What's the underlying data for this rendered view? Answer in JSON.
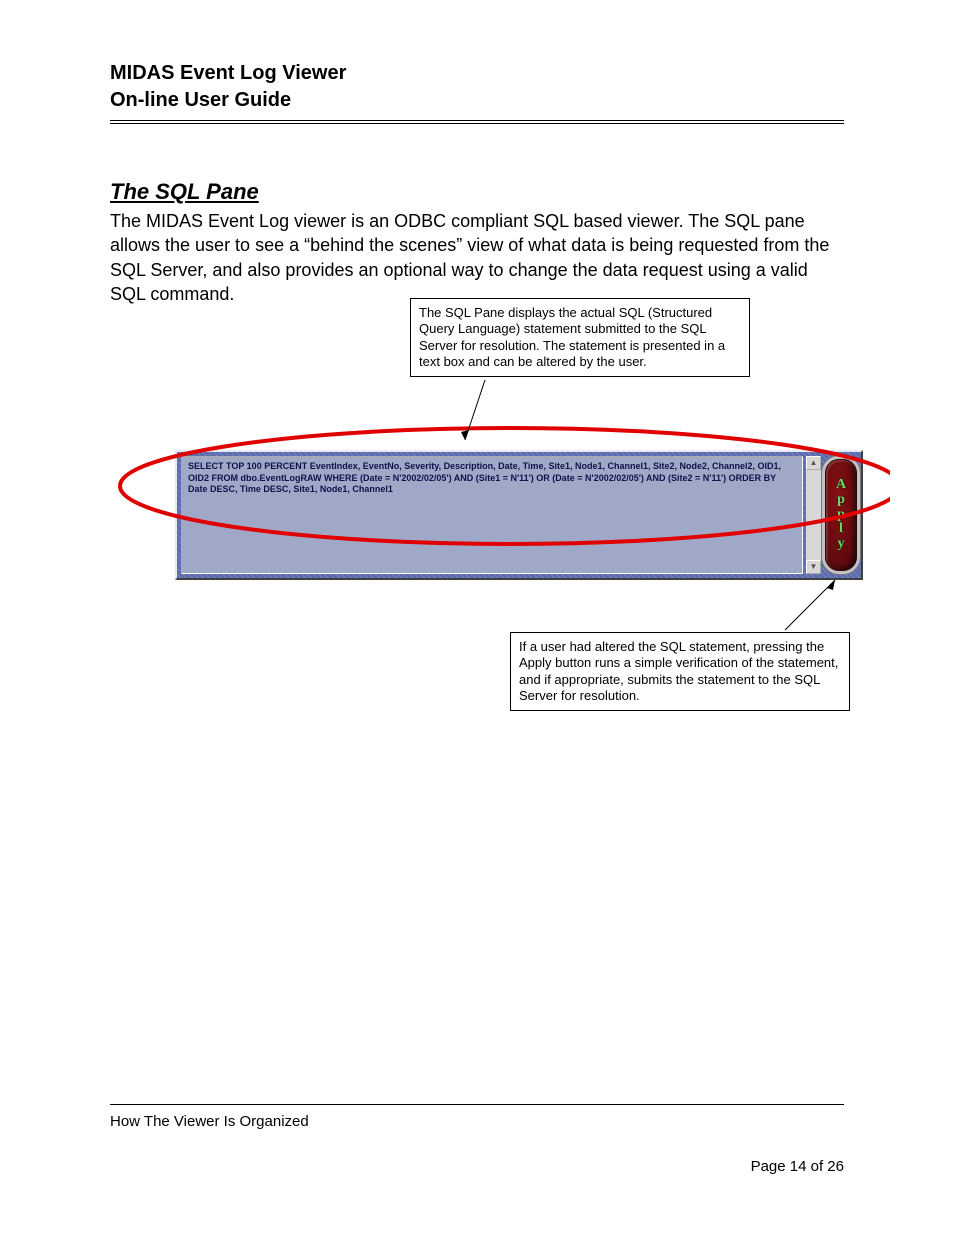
{
  "header": {
    "line1": "MIDAS Event Log Viewer",
    "line2": "On-line User Guide"
  },
  "section": {
    "title": "The SQL Pane",
    "body": "The MIDAS Event Log viewer is an ODBC compliant SQL based viewer.  The SQL pane allows the user to see a “behind the scenes” view of what data is being requested from the SQL Server, and also provides an optional way to change the data request using a valid SQL command."
  },
  "callout_top": "The SQL Pane displays the actual SQL (Structured Query Language) statement submitted to the SQL Server for resolution.  The statement is presented in a text box and can be altered by the user.",
  "callout_bottom": "If a user had altered the SQL statement, pressing the Apply button runs a simple verification of the statement, and if appropriate, submits the statement to the SQL Server for resolution.",
  "sql_pane": {
    "text": "SELECT TOP 100 PERCENT EventIndex, EventNo, Severity, Description, Date, Time, Site1, Node1, Channel1, Site2, Node2, Channel2, OID1, OID2 FROM  dbo.EventLogRAW WHERE (Date = N'2002/02/05') AND (Site1 = N'11') OR (Date = N'2002/02/05') AND (Site2 = N'11') ORDER BY Date DESC, Time DESC, Site1, Node1, Channel1",
    "apply_label": "Apply"
  },
  "footer": {
    "left": "How The Viewer Is Organized",
    "page": "Page 14 of 26"
  }
}
